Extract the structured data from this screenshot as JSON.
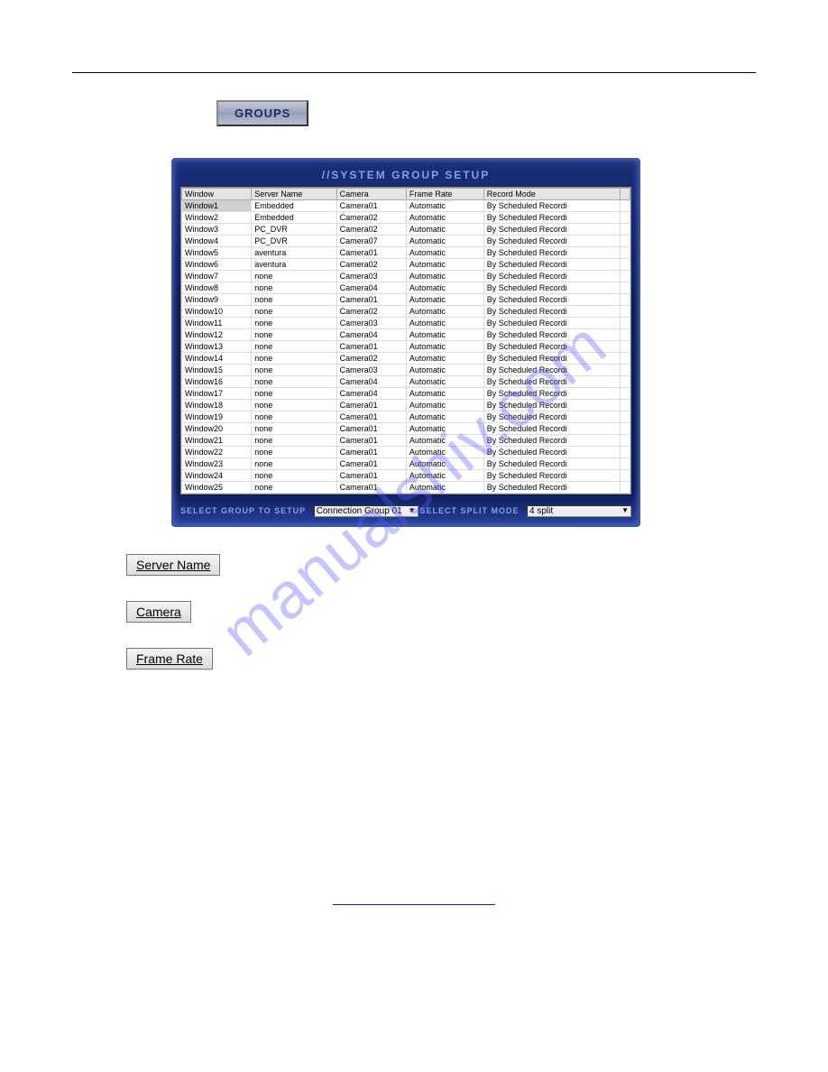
{
  "buttons": {
    "groups": "GROUPS"
  },
  "panel": {
    "title": "//SYSTEM GROUP SETUP",
    "columns": [
      "Window",
      "Server Name",
      "Camera",
      "Frame Rate",
      "Record Mode",
      ""
    ],
    "rows": [
      {
        "window": "Window1",
        "server": "Embedded",
        "camera": "Camera01",
        "frame": "Automatic",
        "record": "By Scheduled Recordi",
        "sel": true
      },
      {
        "window": "Window2",
        "server": "Embedded",
        "camera": "Camera02",
        "frame": "Automatic",
        "record": "By Scheduled Recordi"
      },
      {
        "window": "Window3",
        "server": "PC_DVR",
        "camera": "Camera02",
        "frame": "Automatic",
        "record": "By Scheduled Recordi"
      },
      {
        "window": "Window4",
        "server": "PC_DVR",
        "camera": "Camera07",
        "frame": "Automatic",
        "record": "By Scheduled Recordi"
      },
      {
        "window": "Window5",
        "server": "aventura",
        "camera": "Camera01",
        "frame": "Automatic",
        "record": "By Scheduled Recordi"
      },
      {
        "window": "Window6",
        "server": "aventura",
        "camera": "Camera02",
        "frame": "Automatic",
        "record": "By Scheduled Recordi"
      },
      {
        "window": "Window7",
        "server": "none",
        "camera": "Camera03",
        "frame": "Automatic",
        "record": "By Scheduled Recordi"
      },
      {
        "window": "Window8",
        "server": "none",
        "camera": "Camera04",
        "frame": "Automatic",
        "record": "By Scheduled Recordi"
      },
      {
        "window": "Window9",
        "server": "none",
        "camera": "Camera01",
        "frame": "Automatic",
        "record": "By Scheduled Recordi"
      },
      {
        "window": "Window10",
        "server": "none",
        "camera": "Camera02",
        "frame": "Automatic",
        "record": "By Scheduled Recordi"
      },
      {
        "window": "Window11",
        "server": "none",
        "camera": "Camera03",
        "frame": "Automatic",
        "record": "By Scheduled Recordi"
      },
      {
        "window": "Window12",
        "server": "none",
        "camera": "Camera04",
        "frame": "Automatic",
        "record": "By Scheduled Recordi"
      },
      {
        "window": "Window13",
        "server": "none",
        "camera": "Camera01",
        "frame": "Automatic",
        "record": "By Scheduled Recordi"
      },
      {
        "window": "Window14",
        "server": "none",
        "camera": "Camera02",
        "frame": "Automatic",
        "record": "By Scheduled Recordi"
      },
      {
        "window": "Window15",
        "server": "none",
        "camera": "Camera03",
        "frame": "Automatic",
        "record": "By Scheduled Recordi"
      },
      {
        "window": "Window16",
        "server": "none",
        "camera": "Camera04",
        "frame": "Automatic",
        "record": "By Scheduled Recordi"
      },
      {
        "window": "Window17",
        "server": "none",
        "camera": "Camera04",
        "frame": "Automatic",
        "record": "By Scheduled Recordi"
      },
      {
        "window": "Window18",
        "server": "none",
        "camera": "Camera01",
        "frame": "Automatic",
        "record": "By Scheduled Recordi"
      },
      {
        "window": "Window19",
        "server": "none",
        "camera": "Camera01",
        "frame": "Automatic",
        "record": "By Scheduled Recordi"
      },
      {
        "window": "Window20",
        "server": "none",
        "camera": "Camera01",
        "frame": "Automatic",
        "record": "By Scheduled Recordi"
      },
      {
        "window": "Window21",
        "server": "none",
        "camera": "Camera01",
        "frame": "Automatic",
        "record": "By Scheduled Recordi"
      },
      {
        "window": "Window22",
        "server": "none",
        "camera": "Camera01",
        "frame": "Automatic",
        "record": "By Scheduled Recordi"
      },
      {
        "window": "Window23",
        "server": "none",
        "camera": "Camera01",
        "frame": "Automatic",
        "record": "By Scheduled Recordi"
      },
      {
        "window": "Window24",
        "server": "none",
        "camera": "Camera01",
        "frame": "Automatic",
        "record": "By Scheduled Recordi"
      },
      {
        "window": "Window25",
        "server": "none",
        "camera": "Camera01",
        "frame": "Automatic",
        "record": "By Scheduled Recordi"
      }
    ],
    "select_group_label": "SELECT GROUP TO SETUP",
    "select_group_value": "Connection Group 01",
    "select_split_label": "SELECT SPLIT MODE",
    "select_split_value": "4 split"
  },
  "column_buttons": {
    "server_name": "Server Name",
    "camera": "Camera",
    "frame_rate": "Frame Rate"
  },
  "watermark": "manualshiv.com"
}
